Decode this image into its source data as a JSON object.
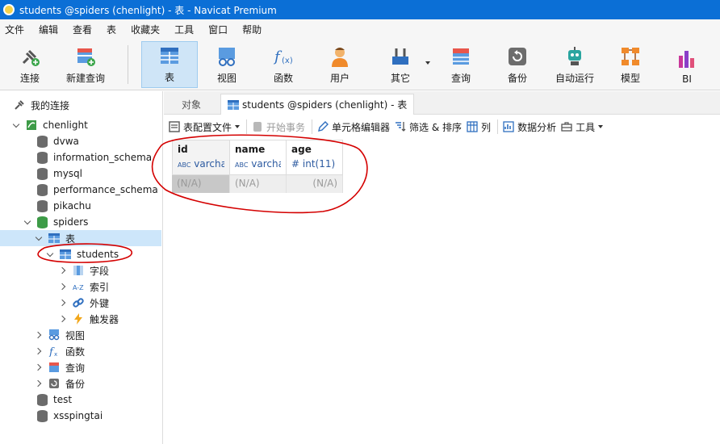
{
  "window": {
    "title": "students @spiders (chenlight) - 表 - Navicat Premium"
  },
  "menu": [
    "文件",
    "编辑",
    "查看",
    "表",
    "收藏夹",
    "工具",
    "窗口",
    "帮助"
  ],
  "toolbar": {
    "connect": "连接",
    "new_query": "新建查询",
    "table": "表",
    "view": "视图",
    "function": "函数",
    "user": "用户",
    "other": "其它",
    "query": "查询",
    "backup": "备份",
    "automation": "自动运行",
    "model": "模型",
    "bi": "BI"
  },
  "sidebar": {
    "my_connections": "我的连接",
    "connection": "chenlight",
    "databases": [
      "dvwa",
      "information_schema",
      "mysql",
      "performance_schema",
      "pikachu"
    ],
    "current_db": "spiders",
    "tables_node": "表",
    "table_students": "students",
    "fields": "字段",
    "indexes": "索引",
    "foreign_keys": "外键",
    "triggers": "触发器",
    "views": "视图",
    "functions": "函数",
    "queries": "查询",
    "backups": "备份",
    "other_dbs": [
      "test",
      "xsspingtai"
    ]
  },
  "tabs": {
    "objects": "对象",
    "active": "students @spiders (chenlight) - 表"
  },
  "subtoolbar": {
    "table_config": "表配置文件",
    "begin_transaction": "开始事务",
    "cell_editor": "单元格编辑器",
    "filter_sort": "筛选 & 排序",
    "columns": "列",
    "data_analysis": "数据分析",
    "tools": "工具"
  },
  "grid": {
    "columns": [
      {
        "name": "id",
        "type_prefix": "ABC",
        "type": "varchar"
      },
      {
        "name": "name",
        "type_prefix": "ABC",
        "type": "varchar"
      },
      {
        "name": "age",
        "type_prefix": "#",
        "type": "int(11)"
      }
    ],
    "row": [
      "(N/A)",
      "(N/A)",
      "(N/A)"
    ]
  },
  "colors": {
    "titlebar": "#0b6fd6",
    "selected": "#cde6fa",
    "annotation": "#d40000"
  }
}
